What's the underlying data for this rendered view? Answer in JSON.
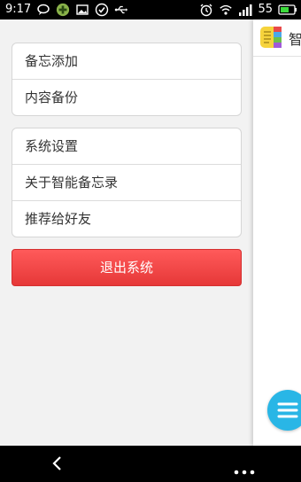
{
  "status_bar": {
    "time": "9:17",
    "battery_level": "55",
    "left_icons": [
      "chat-bubble-icon",
      "game-app-icon",
      "image-icon",
      "check-circle-icon",
      "usb-icon"
    ],
    "right_icons": [
      "alarm-icon",
      "wifi-icon",
      "signal-icon",
      "battery-icon"
    ]
  },
  "drawer": {
    "group1": [
      {
        "label": "备忘添加"
      },
      {
        "label": "内容备份"
      }
    ],
    "group2": [
      {
        "label": "系统设置"
      },
      {
        "label": "关于智能备忘录"
      },
      {
        "label": "推荐给好友"
      }
    ],
    "logout_label": "退出系统"
  },
  "main_panel": {
    "header_title": "智",
    "app_icon": "notebook-app-icon",
    "fab_icon": "menu-icon"
  },
  "nav_bar": {
    "back_icon": "back-icon",
    "more_icon": "more-icon"
  },
  "colors": {
    "logout_button": "#f04848",
    "fab": "#29b6e6",
    "status_bar": "#000000",
    "background": "#f2f2f2"
  }
}
